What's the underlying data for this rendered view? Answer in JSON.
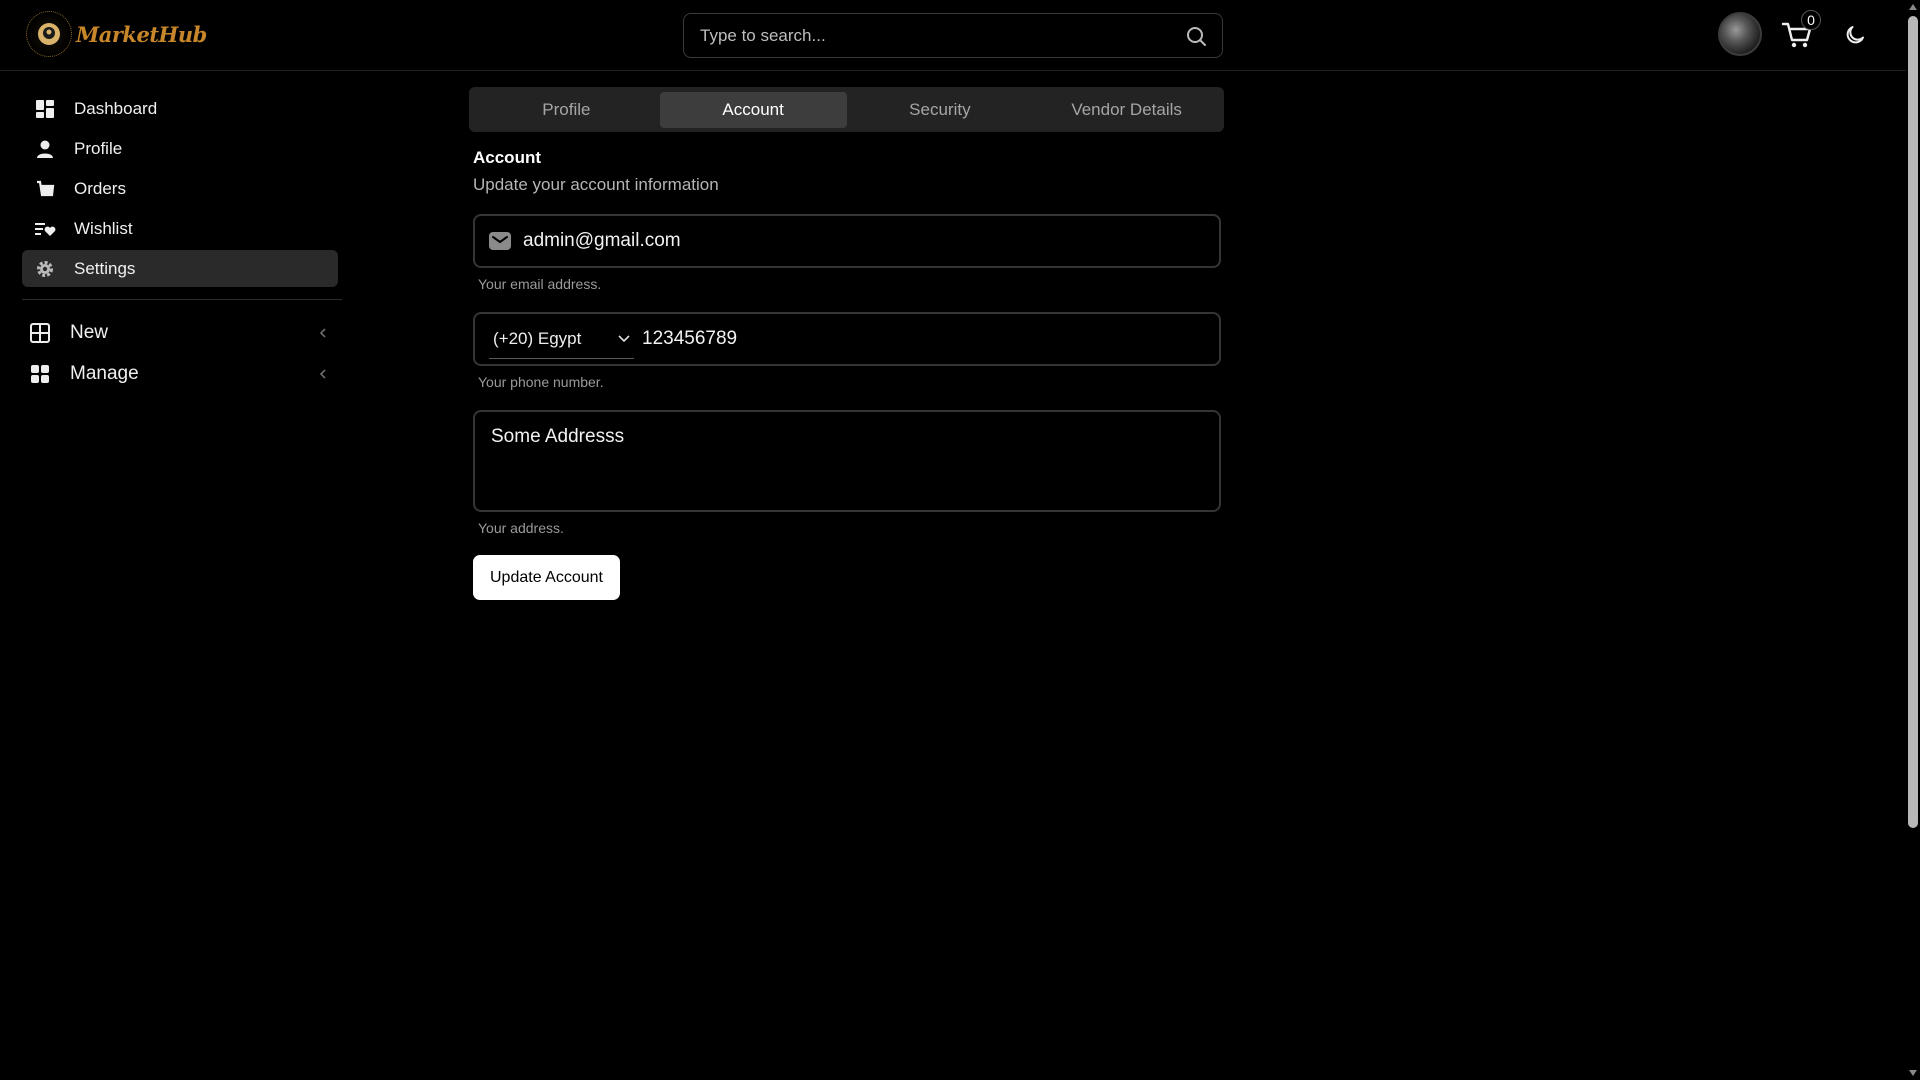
{
  "brand": {
    "name": "MarketHub"
  },
  "search": {
    "placeholder": "Type to search..."
  },
  "cart": {
    "count": "0"
  },
  "sidebar": {
    "items": [
      {
        "label": "Dashboard",
        "icon": "dashboard-icon"
      },
      {
        "label": "Profile",
        "icon": "user-icon"
      },
      {
        "label": "Orders",
        "icon": "orders-icon"
      },
      {
        "label": "Wishlist",
        "icon": "wishlist-icon"
      },
      {
        "label": "Settings",
        "icon": "gear-icon",
        "active": true
      }
    ],
    "groups": [
      {
        "label": "New",
        "icon": "grid-plus-icon"
      },
      {
        "label": "Manage",
        "icon": "grid-icon"
      }
    ]
  },
  "tabs": [
    {
      "label": "Profile"
    },
    {
      "label": "Account",
      "active": true
    },
    {
      "label": "Security"
    },
    {
      "label": "Vendor Details"
    }
  ],
  "form": {
    "title": "Account",
    "subtitle": "Update your account information",
    "email": {
      "value": "admin@gmail.com",
      "hint": "Your email address."
    },
    "phone": {
      "country": "(+20) Egypt",
      "value": "123456789",
      "hint": "Your phone number."
    },
    "address": {
      "value": "Some Addresss",
      "hint": "Your address."
    },
    "submit_label": "Update Account"
  },
  "colors": {
    "background": "#000000",
    "accent": "#c8862a",
    "active_bg": "#2a2a2a"
  }
}
